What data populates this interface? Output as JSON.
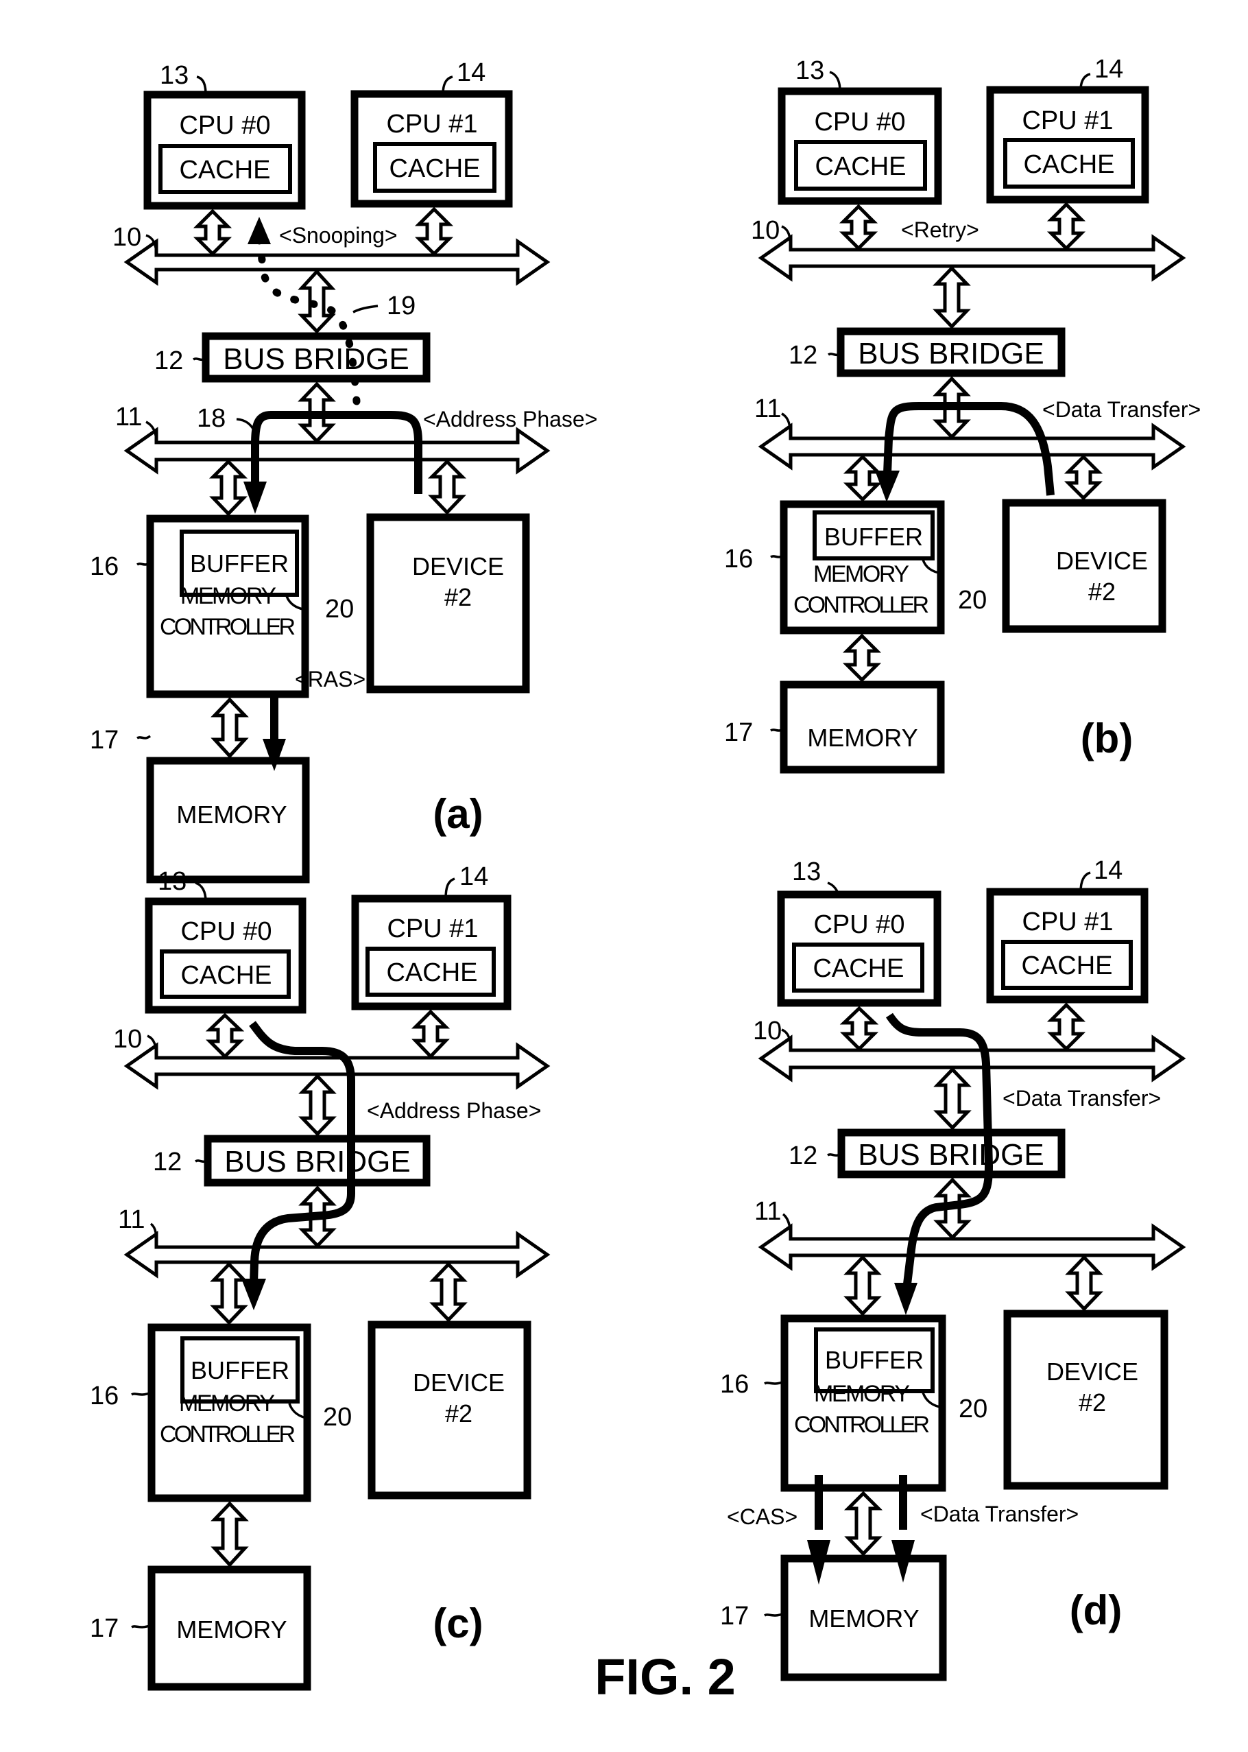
{
  "figure": {
    "title": "FIG. 2",
    "colors": {
      "ink": "#000000",
      "paper": "#ffffff"
    }
  },
  "labels": {
    "cpu0": "CPU #0",
    "cpu1": "CPU #1",
    "cache": "CACHE",
    "bus_bridge": "BUS BRIDGE",
    "buffer": "BUFFER",
    "memory_controller_line1": "MEMORY",
    "memory_controller_line2": "CONTROLLER",
    "device_line1": "DEVICE",
    "device_line2": "#2",
    "memory": "MEMORY"
  },
  "reference_numerals": {
    "system_bus": "10",
    "local_bus": "11",
    "bus_bridge": "12",
    "cpu0": "13",
    "cpu1": "14",
    "memory_controller": "16",
    "memory": "17",
    "address_path": "18",
    "snoop_path": "19",
    "buffer": "20"
  },
  "panels": [
    {
      "id": "a",
      "label": "(a)",
      "signals": [
        "<Snooping>",
        "<Address Phase>",
        "<RAS>"
      ],
      "show_ref_18": true,
      "show_ref_19": true
    },
    {
      "id": "b",
      "label": "(b)",
      "signals": [
        "<Retry>",
        "<Data Transfer>"
      ]
    },
    {
      "id": "c",
      "label": "(c)",
      "signals": [
        "<Address Phase>"
      ]
    },
    {
      "id": "d",
      "label": "(d)",
      "signals": [
        "<Data Transfer>",
        "<CAS>",
        "<Data Transfer>"
      ]
    }
  ]
}
